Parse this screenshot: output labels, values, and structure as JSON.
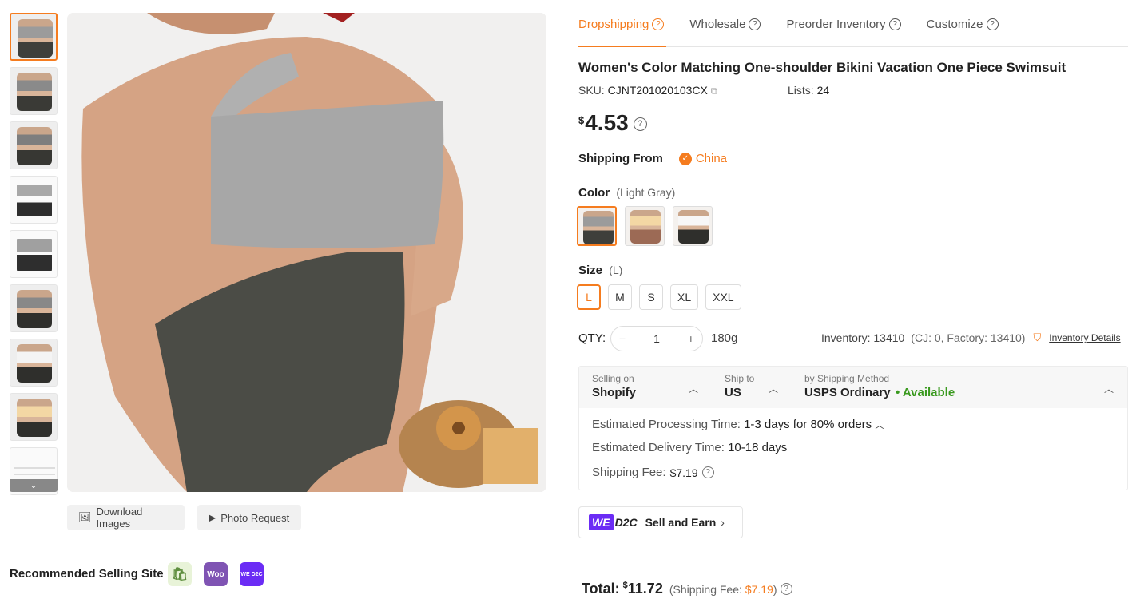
{
  "tabs": [
    {
      "label": "Dropshipping",
      "active": true
    },
    {
      "label": "Wholesale",
      "active": false
    },
    {
      "label": "Preorder Inventory",
      "active": false
    },
    {
      "label": "Customize",
      "active": false
    }
  ],
  "product": {
    "title": "Women's Color Matching One-shoulder Bikini Vacation One Piece Swimsuit",
    "sku_label": "SKU:",
    "sku": "CJNT201020103CX",
    "lists_label": "Lists:",
    "lists": "24",
    "currency": "$",
    "price": "4.53"
  },
  "shipping_from": {
    "label": "Shipping From",
    "value": "China"
  },
  "color": {
    "label": "Color",
    "selected": "(Light Gray)"
  },
  "size": {
    "label": "Size",
    "selected": "(L)",
    "options": [
      "L",
      "M",
      "S",
      "XL",
      "XXL"
    ]
  },
  "qty": {
    "label": "QTY:",
    "minus": "−",
    "value": "1",
    "plus": "+",
    "weight": "180g"
  },
  "inventory": {
    "text": "Inventory: 13410",
    "detail": "(CJ: 0, Factory: 13410)",
    "link": "Inventory Details"
  },
  "ship_selector": {
    "selling_on_label": "Selling on",
    "selling_on": "Shopify",
    "ship_to_label": "Ship to",
    "ship_to": "US",
    "method_label": "by Shipping Method",
    "method": "USPS Ordinary",
    "availability": "• Available"
  },
  "ship_info": {
    "processing_label": "Estimated Processing Time:",
    "processing": "1-3 days for 80% orders",
    "delivery_label": "Estimated Delivery Time:",
    "delivery": "10-18 days",
    "fee_label": "Shipping Fee:",
    "fee": "$7.19"
  },
  "d2c": {
    "we": "WE",
    "d2c": "D2C",
    "label": "Sell and Earn"
  },
  "total": {
    "label": "Total:",
    "currency": "$",
    "value": "11.72",
    "fee_prefix": "(Shipping Fee:",
    "fee": "$7.19",
    "fee_suffix": ")"
  },
  "buttons": {
    "download": "Download Images",
    "photo": "Photo Request"
  },
  "recommended": {
    "label": "Recommended Selling Site",
    "sites": [
      "shopify-icon",
      "woocommerce-icon",
      "we-d2c-icon"
    ],
    "woo": "Woo",
    "we": "WE D2C"
  },
  "colors": {
    "accent": "#f57c1f",
    "green": "#3a9a1f",
    "purple": "#6b2cf5"
  }
}
